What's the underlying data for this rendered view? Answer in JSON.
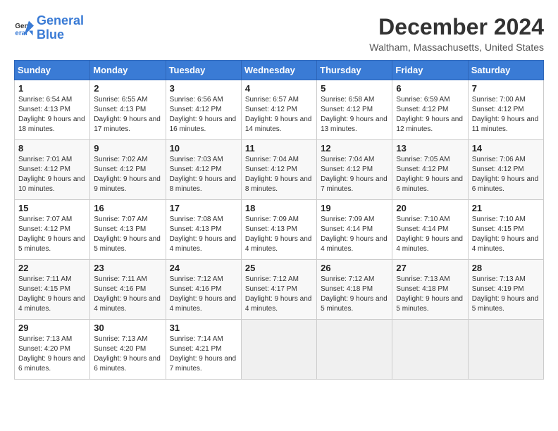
{
  "header": {
    "logo_line1": "General",
    "logo_line2": "Blue",
    "month_title": "December 2024",
    "location": "Waltham, Massachusetts, United States"
  },
  "days_of_week": [
    "Sunday",
    "Monday",
    "Tuesday",
    "Wednesday",
    "Thursday",
    "Friday",
    "Saturday"
  ],
  "weeks": [
    [
      {
        "day": "1",
        "sunrise": "6:54 AM",
        "sunset": "4:13 PM",
        "daylight": "9 hours and 18 minutes."
      },
      {
        "day": "2",
        "sunrise": "6:55 AM",
        "sunset": "4:13 PM",
        "daylight": "9 hours and 17 minutes."
      },
      {
        "day": "3",
        "sunrise": "6:56 AM",
        "sunset": "4:12 PM",
        "daylight": "9 hours and 16 minutes."
      },
      {
        "day": "4",
        "sunrise": "6:57 AM",
        "sunset": "4:12 PM",
        "daylight": "9 hours and 14 minutes."
      },
      {
        "day": "5",
        "sunrise": "6:58 AM",
        "sunset": "4:12 PM",
        "daylight": "9 hours and 13 minutes."
      },
      {
        "day": "6",
        "sunrise": "6:59 AM",
        "sunset": "4:12 PM",
        "daylight": "9 hours and 12 minutes."
      },
      {
        "day": "7",
        "sunrise": "7:00 AM",
        "sunset": "4:12 PM",
        "daylight": "9 hours and 11 minutes."
      }
    ],
    [
      {
        "day": "8",
        "sunrise": "7:01 AM",
        "sunset": "4:12 PM",
        "daylight": "9 hours and 10 minutes."
      },
      {
        "day": "9",
        "sunrise": "7:02 AM",
        "sunset": "4:12 PM",
        "daylight": "9 hours and 9 minutes."
      },
      {
        "day": "10",
        "sunrise": "7:03 AM",
        "sunset": "4:12 PM",
        "daylight": "9 hours and 8 minutes."
      },
      {
        "day": "11",
        "sunrise": "7:04 AM",
        "sunset": "4:12 PM",
        "daylight": "9 hours and 8 minutes."
      },
      {
        "day": "12",
        "sunrise": "7:04 AM",
        "sunset": "4:12 PM",
        "daylight": "9 hours and 7 minutes."
      },
      {
        "day": "13",
        "sunrise": "7:05 AM",
        "sunset": "4:12 PM",
        "daylight": "9 hours and 6 minutes."
      },
      {
        "day": "14",
        "sunrise": "7:06 AM",
        "sunset": "4:12 PM",
        "daylight": "9 hours and 6 minutes."
      }
    ],
    [
      {
        "day": "15",
        "sunrise": "7:07 AM",
        "sunset": "4:12 PM",
        "daylight": "9 hours and 5 minutes."
      },
      {
        "day": "16",
        "sunrise": "7:07 AM",
        "sunset": "4:13 PM",
        "daylight": "9 hours and 5 minutes."
      },
      {
        "day": "17",
        "sunrise": "7:08 AM",
        "sunset": "4:13 PM",
        "daylight": "9 hours and 4 minutes."
      },
      {
        "day": "18",
        "sunrise": "7:09 AM",
        "sunset": "4:13 PM",
        "daylight": "9 hours and 4 minutes."
      },
      {
        "day": "19",
        "sunrise": "7:09 AM",
        "sunset": "4:14 PM",
        "daylight": "9 hours and 4 minutes."
      },
      {
        "day": "20",
        "sunrise": "7:10 AM",
        "sunset": "4:14 PM",
        "daylight": "9 hours and 4 minutes."
      },
      {
        "day": "21",
        "sunrise": "7:10 AM",
        "sunset": "4:15 PM",
        "daylight": "9 hours and 4 minutes."
      }
    ],
    [
      {
        "day": "22",
        "sunrise": "7:11 AM",
        "sunset": "4:15 PM",
        "daylight": "9 hours and 4 minutes."
      },
      {
        "day": "23",
        "sunrise": "7:11 AM",
        "sunset": "4:16 PM",
        "daylight": "9 hours and 4 minutes."
      },
      {
        "day": "24",
        "sunrise": "7:12 AM",
        "sunset": "4:16 PM",
        "daylight": "9 hours and 4 minutes."
      },
      {
        "day": "25",
        "sunrise": "7:12 AM",
        "sunset": "4:17 PM",
        "daylight": "9 hours and 4 minutes."
      },
      {
        "day": "26",
        "sunrise": "7:12 AM",
        "sunset": "4:18 PM",
        "daylight": "9 hours and 5 minutes."
      },
      {
        "day": "27",
        "sunrise": "7:13 AM",
        "sunset": "4:18 PM",
        "daylight": "9 hours and 5 minutes."
      },
      {
        "day": "28",
        "sunrise": "7:13 AM",
        "sunset": "4:19 PM",
        "daylight": "9 hours and 5 minutes."
      }
    ],
    [
      {
        "day": "29",
        "sunrise": "7:13 AM",
        "sunset": "4:20 PM",
        "daylight": "9 hours and 6 minutes."
      },
      {
        "day": "30",
        "sunrise": "7:13 AM",
        "sunset": "4:20 PM",
        "daylight": "9 hours and 6 minutes."
      },
      {
        "day": "31",
        "sunrise": "7:14 AM",
        "sunset": "4:21 PM",
        "daylight": "9 hours and 7 minutes."
      },
      null,
      null,
      null,
      null
    ]
  ],
  "labels": {
    "sunrise": "Sunrise:",
    "sunset": "Sunset:",
    "daylight": "Daylight:"
  }
}
